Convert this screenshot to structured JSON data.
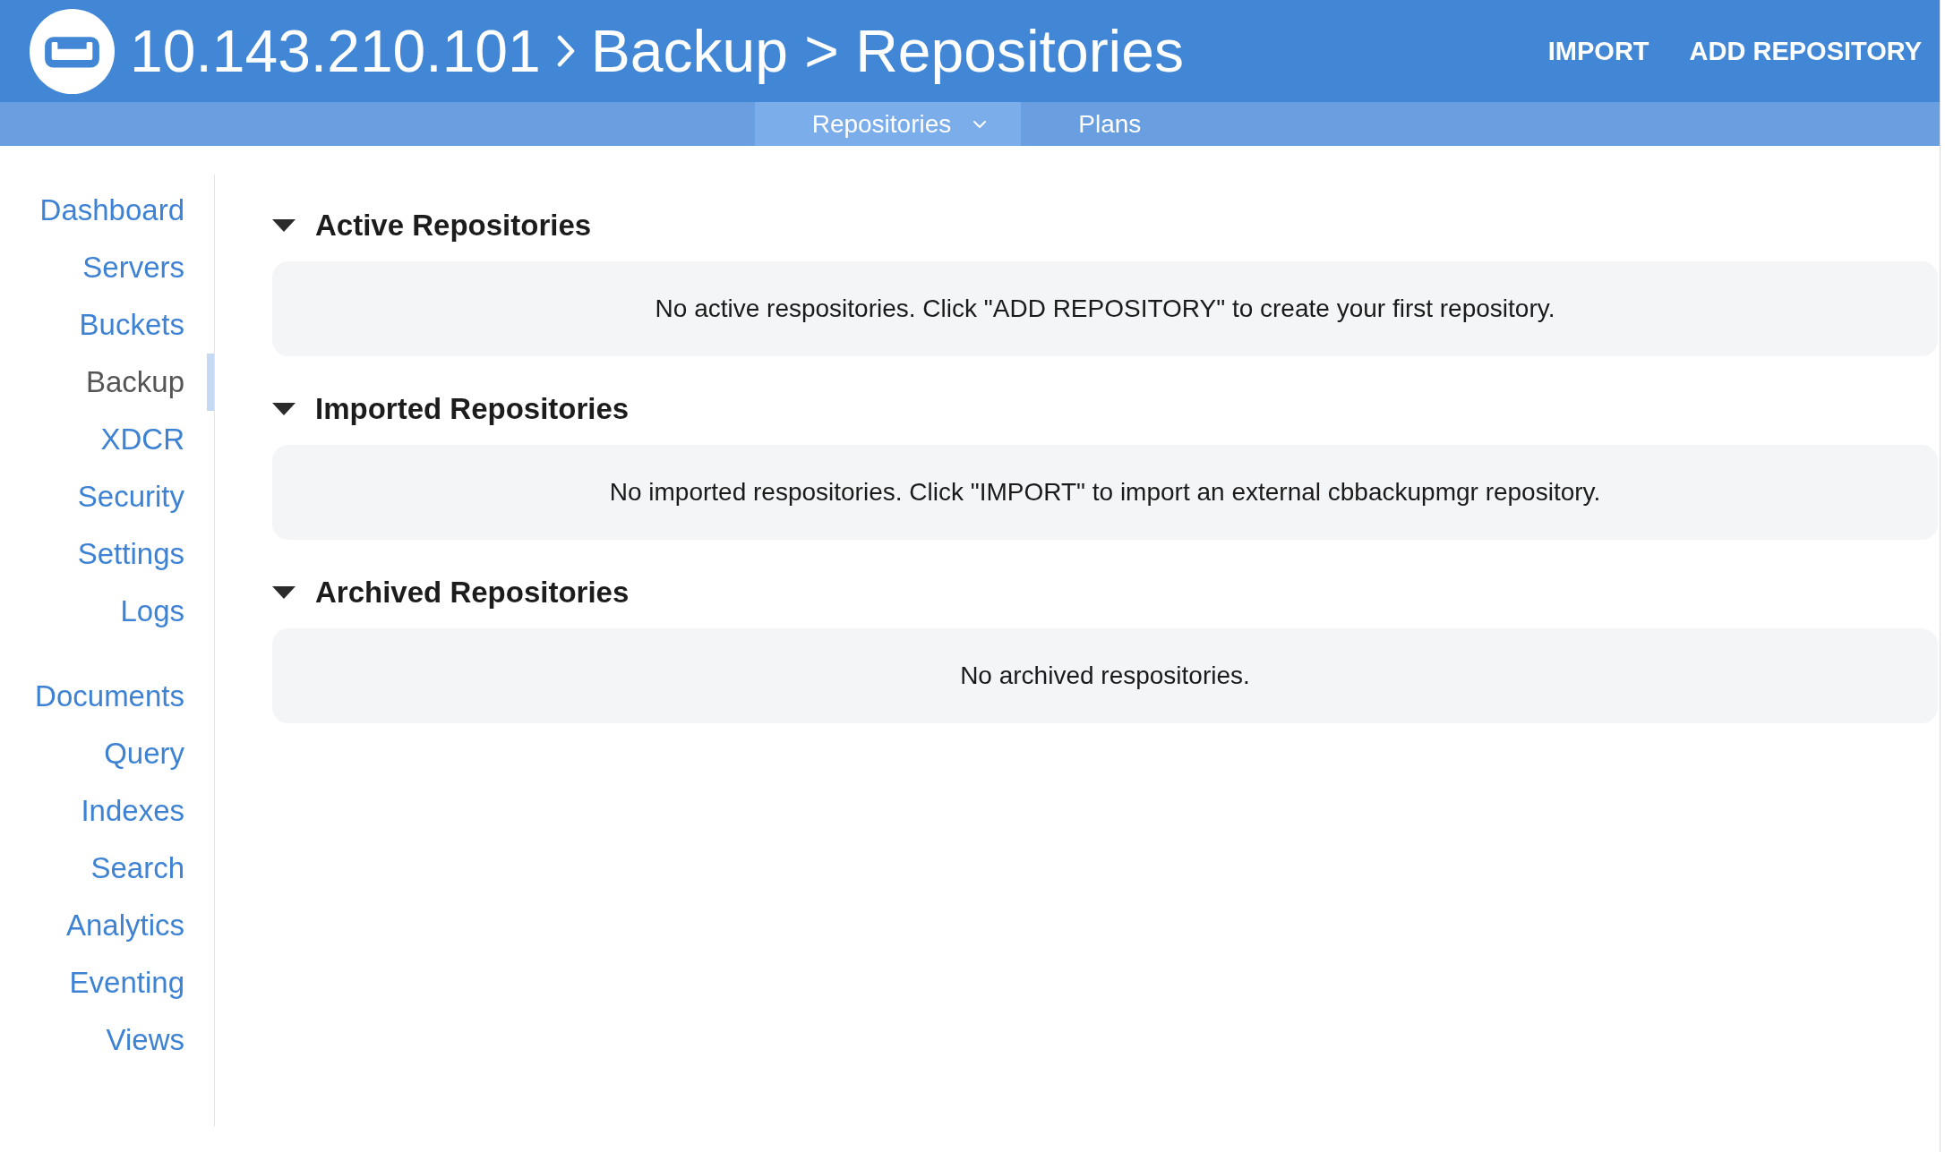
{
  "header": {
    "cluster": "10.143.210.101",
    "breadcrumb": "Backup > Repositories",
    "actions": [
      {
        "label": "IMPORT"
      },
      {
        "label": "ADD REPOSITORY"
      }
    ]
  },
  "subnav": {
    "tabs": [
      {
        "label": "Repositories",
        "selected": true,
        "has_menu": true
      },
      {
        "label": "Plans",
        "selected": false,
        "has_menu": false
      }
    ]
  },
  "sidebar": {
    "groups": [
      {
        "items": [
          {
            "label": "Dashboard",
            "selected": false
          },
          {
            "label": "Servers",
            "selected": false
          },
          {
            "label": "Buckets",
            "selected": false
          },
          {
            "label": "Backup",
            "selected": true
          },
          {
            "label": "XDCR",
            "selected": false
          },
          {
            "label": "Security",
            "selected": false
          },
          {
            "label": "Settings",
            "selected": false
          },
          {
            "label": "Logs",
            "selected": false
          }
        ]
      },
      {
        "items": [
          {
            "label": "Documents",
            "selected": false
          },
          {
            "label": "Query",
            "selected": false
          },
          {
            "label": "Indexes",
            "selected": false
          },
          {
            "label": "Search",
            "selected": false
          },
          {
            "label": "Analytics",
            "selected": false
          },
          {
            "label": "Eventing",
            "selected": false
          },
          {
            "label": "Views",
            "selected": false
          }
        ]
      }
    ]
  },
  "sections": [
    {
      "title": "Active Repositories",
      "expanded": true,
      "message": "No active respositories. Click \"ADD REPOSITORY\" to create your first repository."
    },
    {
      "title": "Imported Repositories",
      "expanded": true,
      "message": "No imported respositories. Click \"IMPORT\" to import an external cbbackupmgr repository."
    },
    {
      "title": "Archived Repositories",
      "expanded": true,
      "message": "No archived respositories."
    }
  ]
}
